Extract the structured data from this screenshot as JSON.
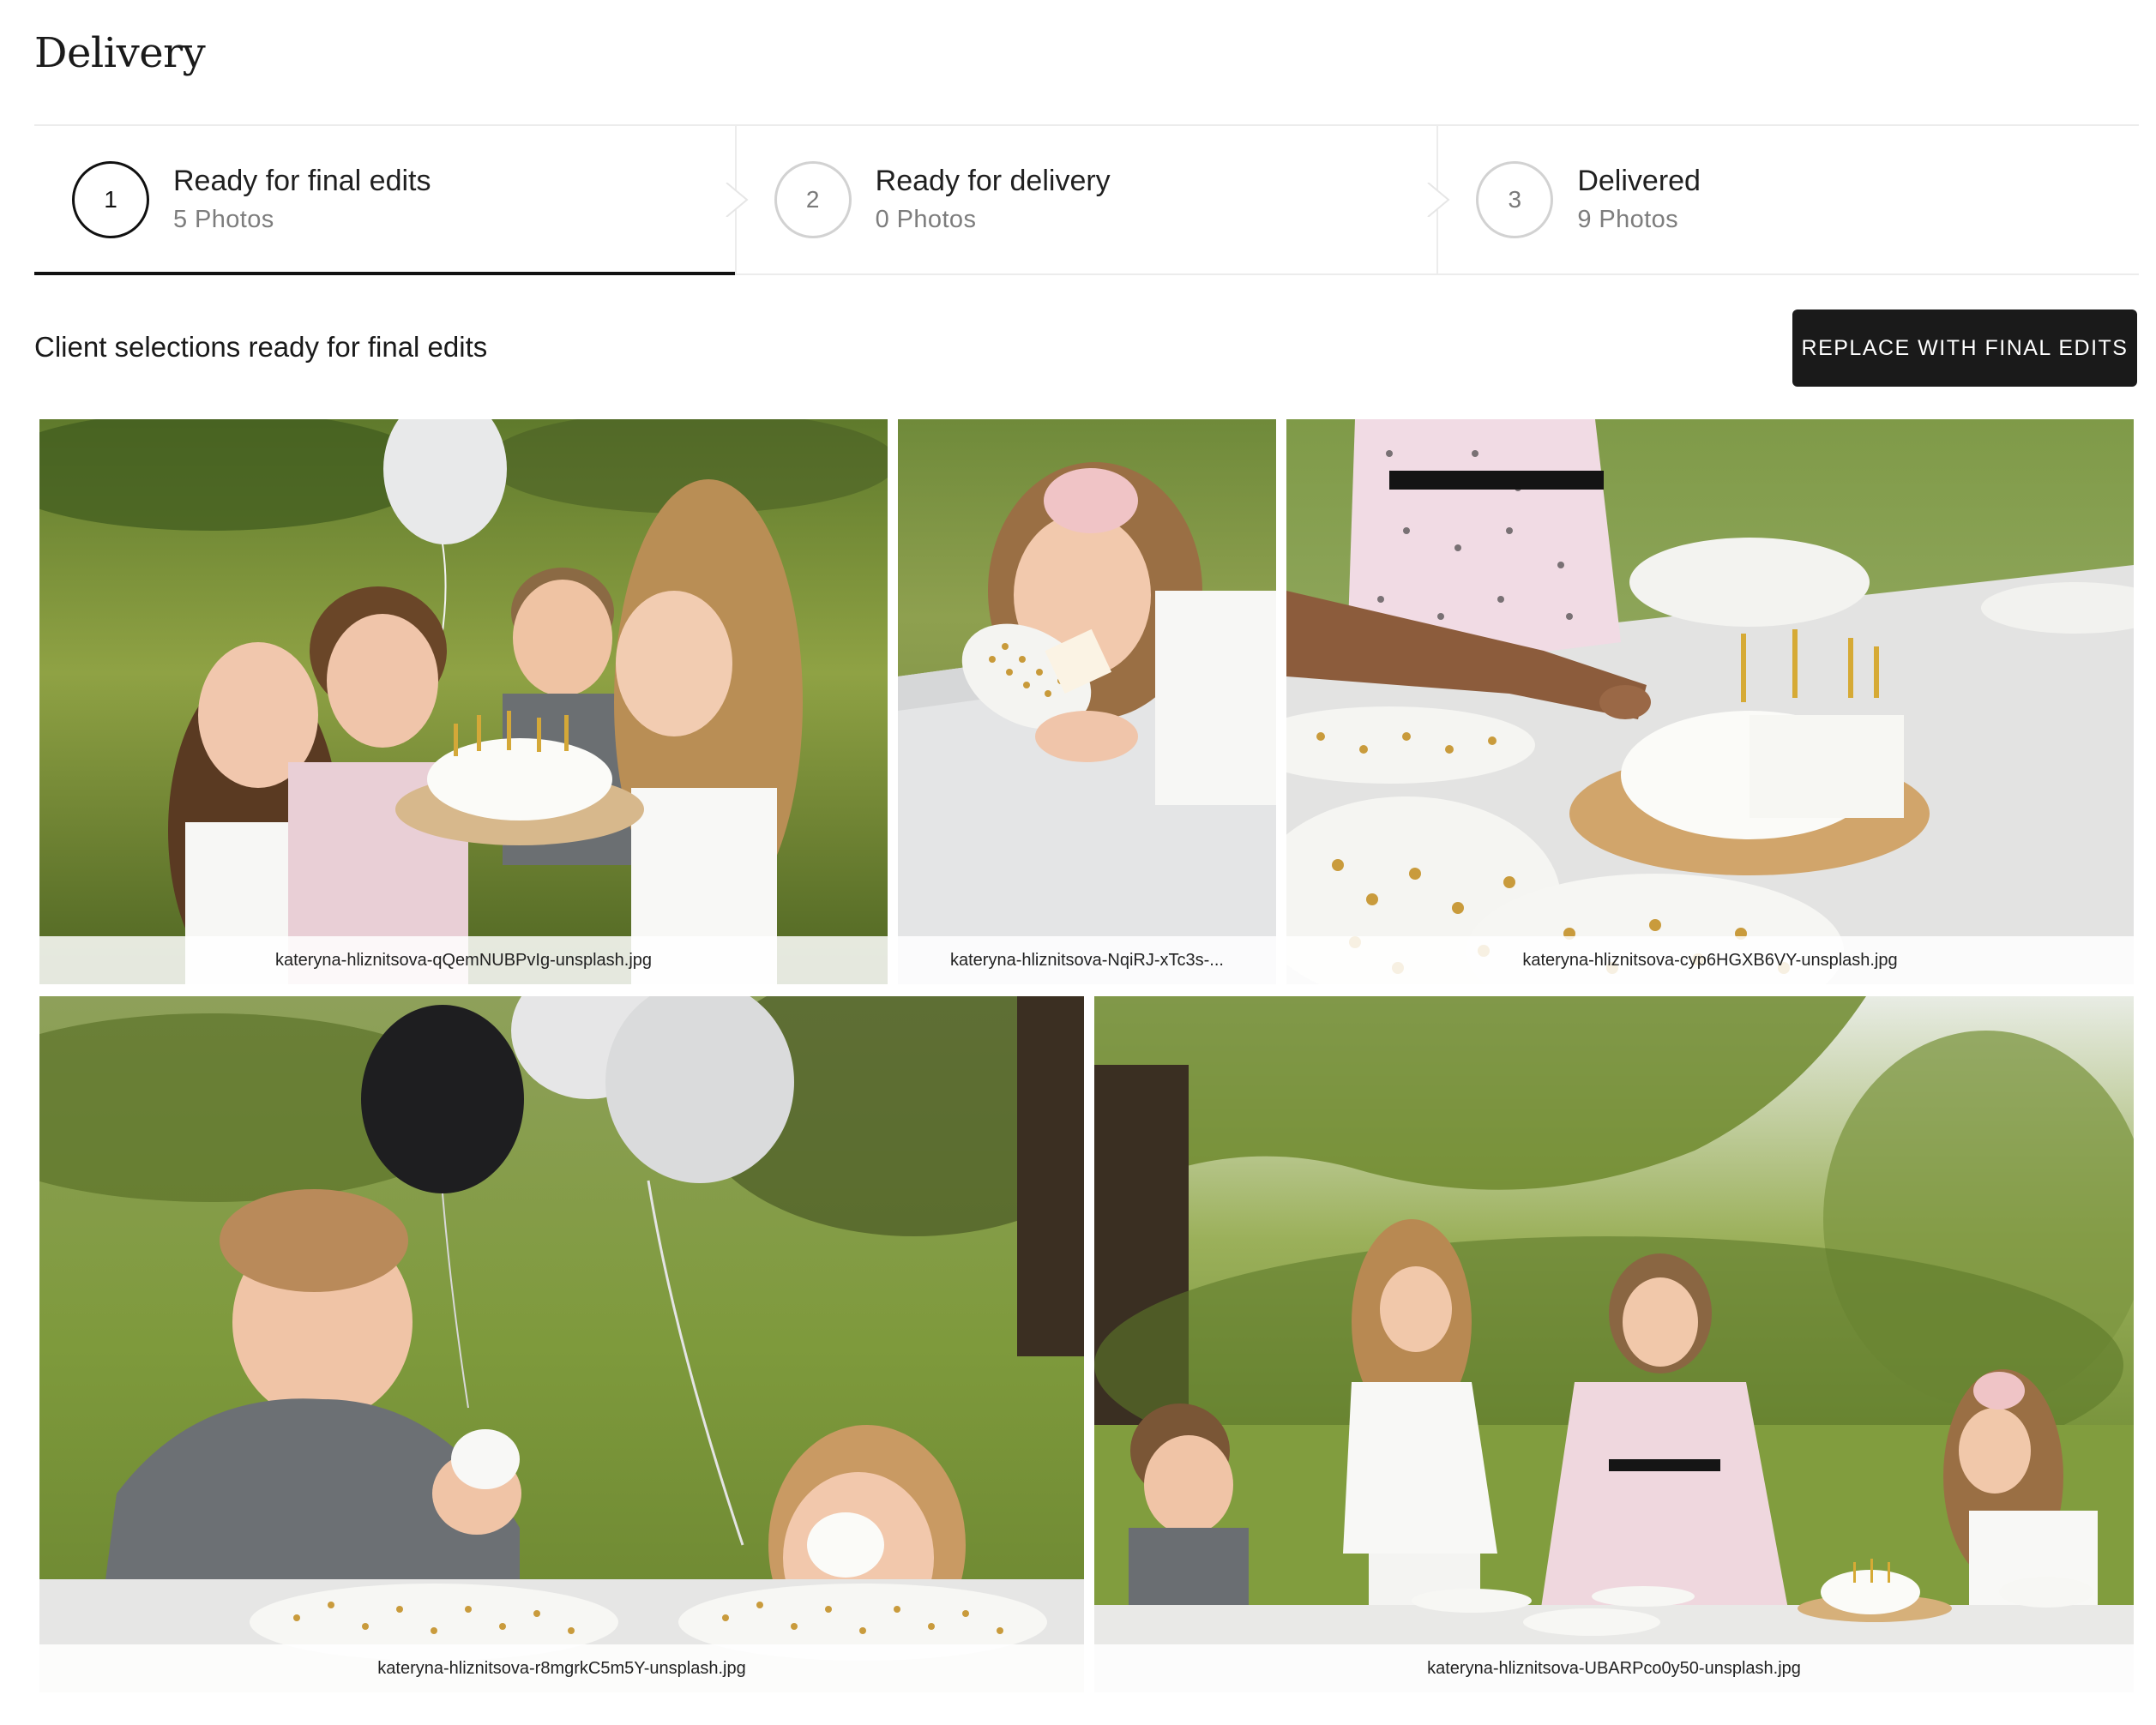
{
  "page": {
    "title": "Delivery"
  },
  "steps": [
    {
      "number": "1",
      "label": "Ready for final edits",
      "count": "5 Photos",
      "active": true
    },
    {
      "number": "2",
      "label": "Ready for delivery",
      "count": "0 Photos",
      "active": false
    },
    {
      "number": "3",
      "label": "Delivered",
      "count": "9 Photos",
      "active": false
    }
  ],
  "section": {
    "heading": "Client selections ready for final edits",
    "action_label": "REPLACE WITH FINAL EDITS"
  },
  "photos": [
    {
      "filename": "kateryna-hliznitsova-qQemNUBPvIg-unsplash.jpg",
      "description": "four children blowing out candles on a birthday cake"
    },
    {
      "filename": "kateryna-hliznitsova-NqiRJ-xTc3s-...",
      "description": "girl with pink bow biting a slice of cake"
    },
    {
      "filename": "kateryna-hliznitsova-cyp6HGXB6VY-unsplash.jpg",
      "description": "children pointing at a cake with gold candles on a table"
    },
    {
      "filename": "kateryna-hliznitsova-r8mgrkC5m5Y-unsplash.jpg",
      "description": "boy and girl eating cake at a table with balloons"
    },
    {
      "filename": "kateryna-hliznitsova-UBARPco0y50-unsplash.jpg",
      "description": "four children eating cake under a willow tree"
    }
  ]
}
